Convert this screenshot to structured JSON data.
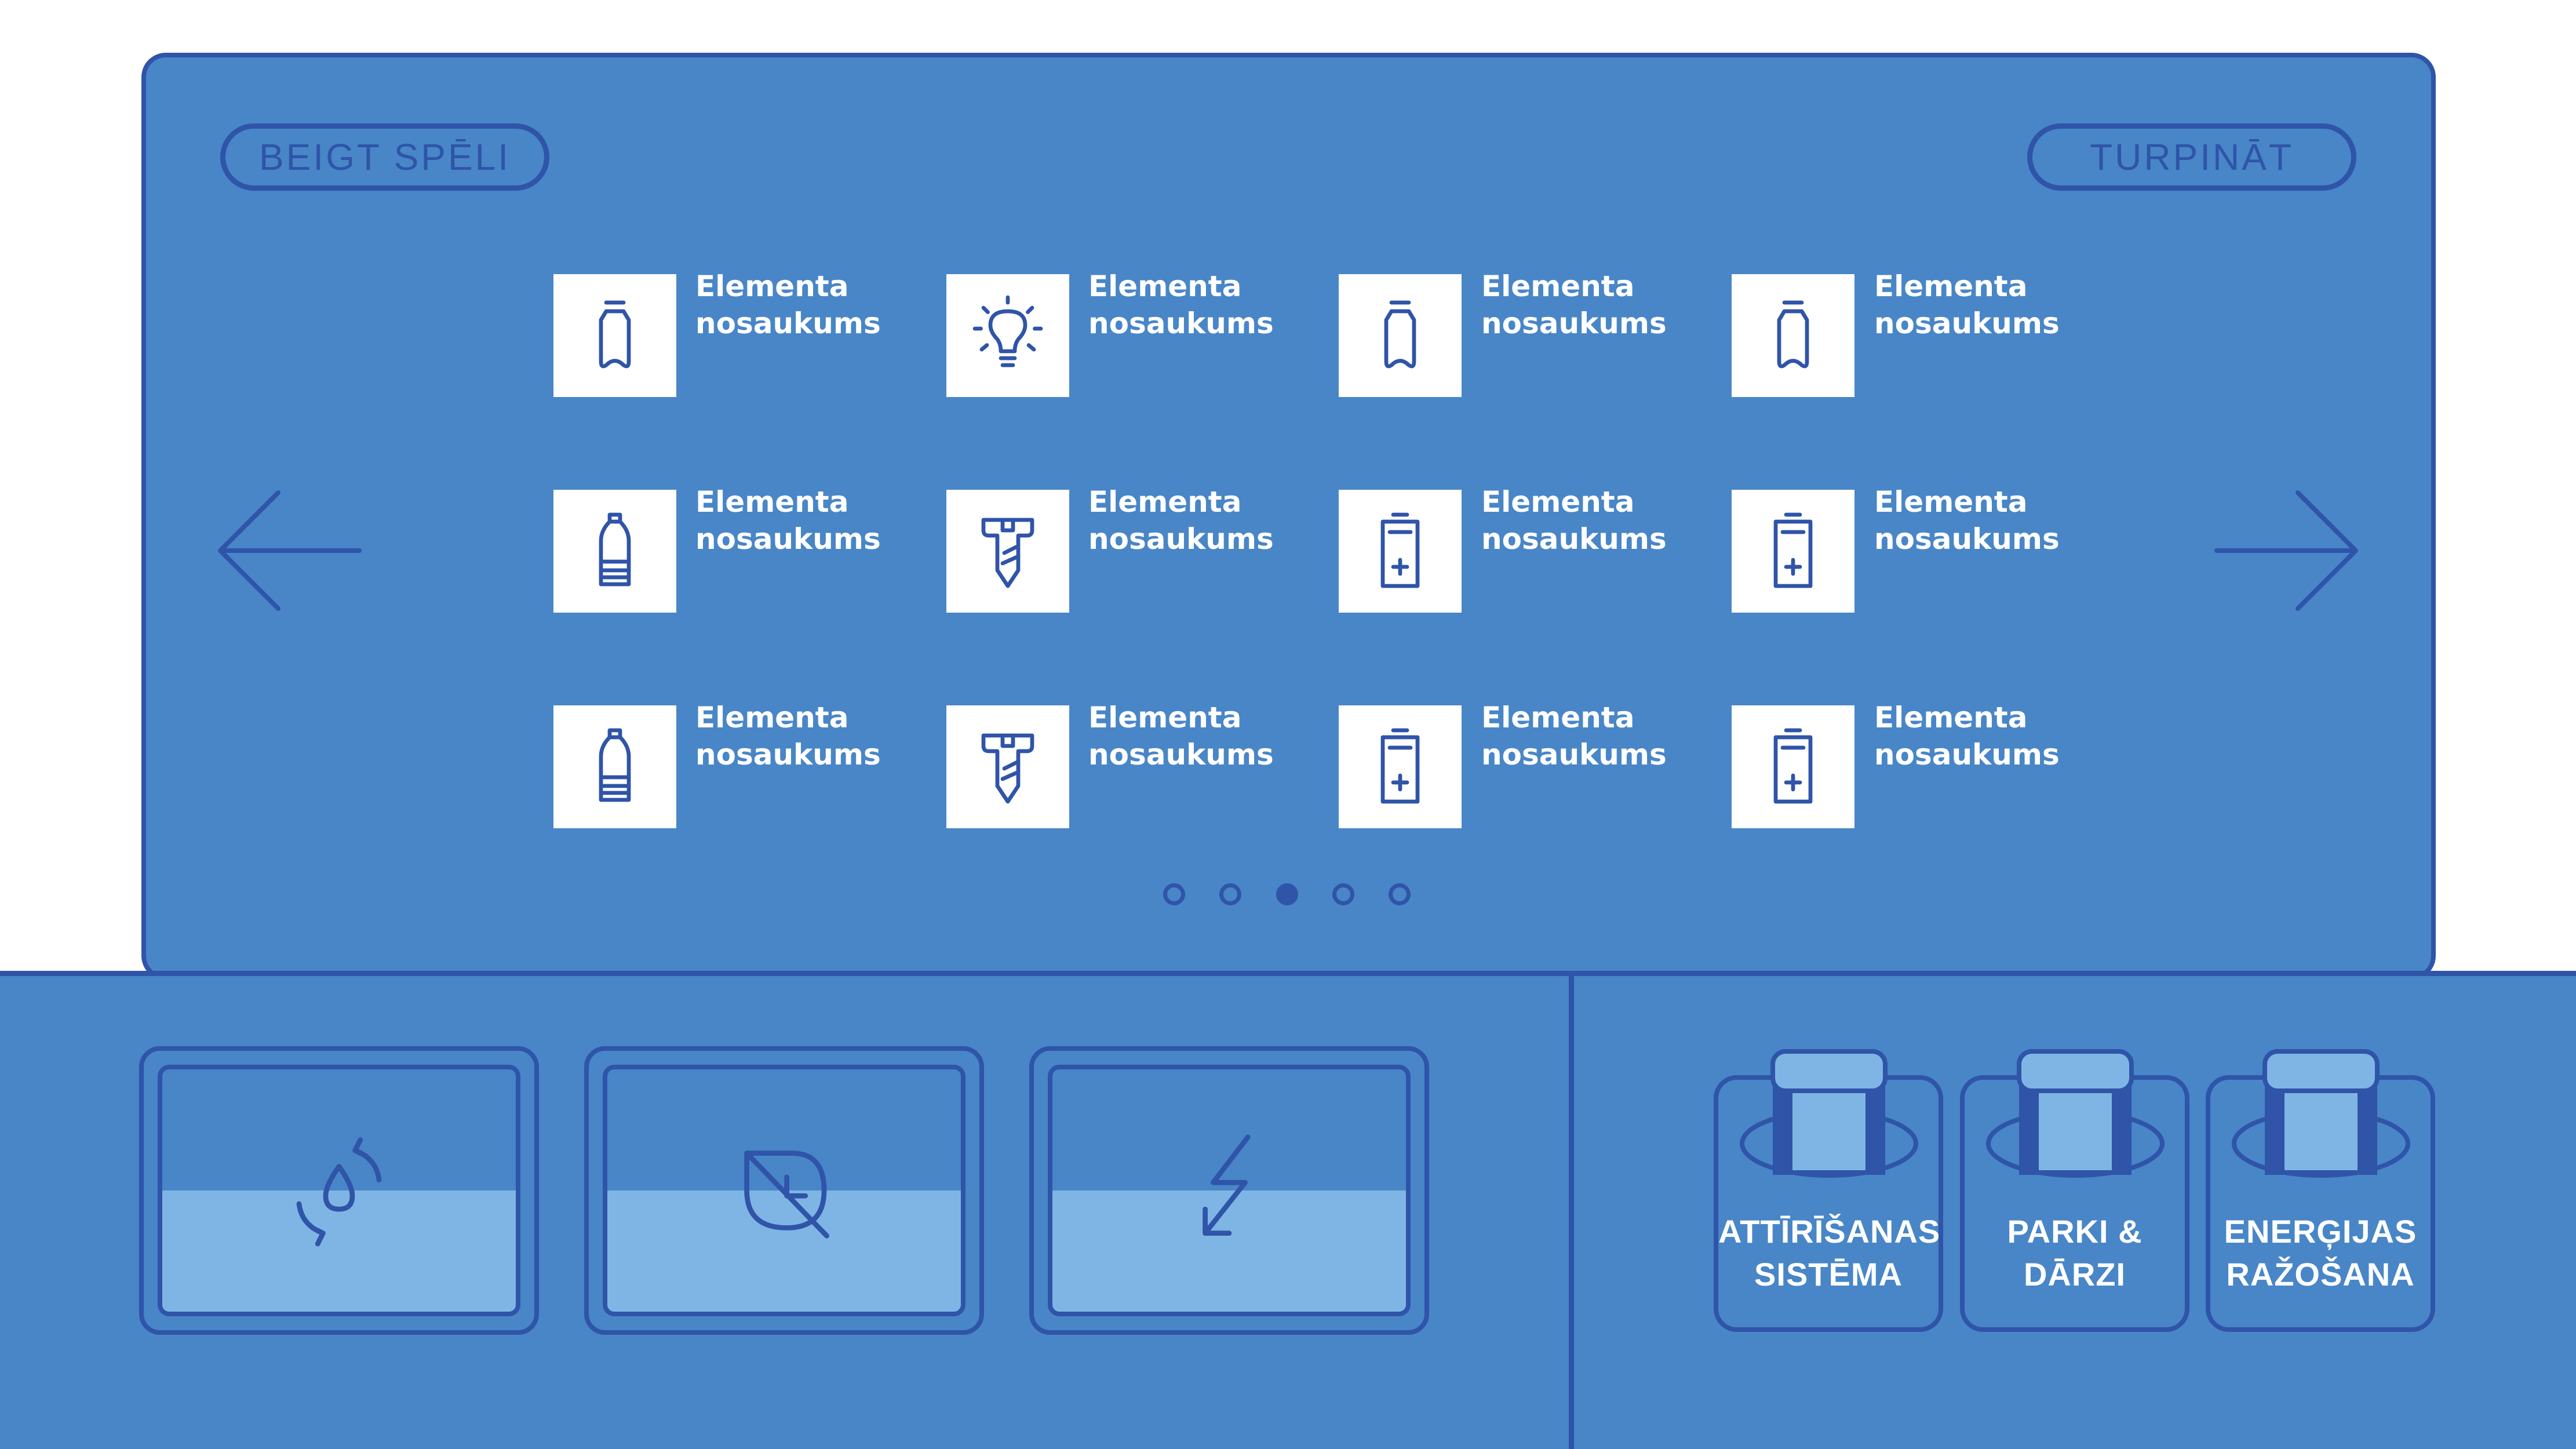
{
  "header": {
    "end_game_label": "BEIGT SPĒLI",
    "continue_label": "TURPINĀT"
  },
  "items": [
    {
      "icon": "bottle-icon",
      "line1": "Elementa",
      "line2": "nosaukums"
    },
    {
      "icon": "light-bulb-icon",
      "line1": "Elementa",
      "line2": "nosaukums"
    },
    {
      "icon": "bottle-icon",
      "line1": "Elementa",
      "line2": "nosaukums"
    },
    {
      "icon": "bottle-icon",
      "line1": "Elementa",
      "line2": "nosaukums"
    },
    {
      "icon": "plastic-bottle-icon",
      "line1": "Elementa",
      "line2": "nosaukums"
    },
    {
      "icon": "screw-icon",
      "line1": "Elementa",
      "line2": "nosaukums"
    },
    {
      "icon": "battery-icon",
      "line1": "Elementa",
      "line2": "nosaukums"
    },
    {
      "icon": "battery-icon",
      "line1": "Elementa",
      "line2": "nosaukums"
    },
    {
      "icon": "plastic-bottle-icon",
      "line1": "Elementa",
      "line2": "nosaukums"
    },
    {
      "icon": "screw-icon",
      "line1": "Elementa",
      "line2": "nosaukums"
    },
    {
      "icon": "battery-icon",
      "line1": "Elementa",
      "line2": "nosaukums"
    },
    {
      "icon": "battery-icon",
      "line1": "Elementa",
      "line2": "nosaukums"
    }
  ],
  "pagination": {
    "total": 5,
    "active": 3
  },
  "gauges": [
    {
      "icon": "water-recycle-icon",
      "level": 0.5
    },
    {
      "icon": "leaf-crossed-icon",
      "level": 0.5
    },
    {
      "icon": "lightning-icon",
      "level": 0.5
    }
  ],
  "categories": [
    {
      "line1": "ATTĪRĪŠANAS",
      "line2": "SISTĒMA",
      "icon": "bin-icon"
    },
    {
      "line1": "PARKI &",
      "line2": "DĀRZI",
      "icon": "bin-icon"
    },
    {
      "line1": "ENERĢIJAS",
      "line2": "RAŽOŠANA",
      "icon": "bin-icon"
    }
  ],
  "colors": {
    "panel": "#4886c7",
    "outline": "#2f54a8",
    "fill_light": "#7fb5e4",
    "tile": "#ffffff",
    "text": "#ffffff"
  }
}
